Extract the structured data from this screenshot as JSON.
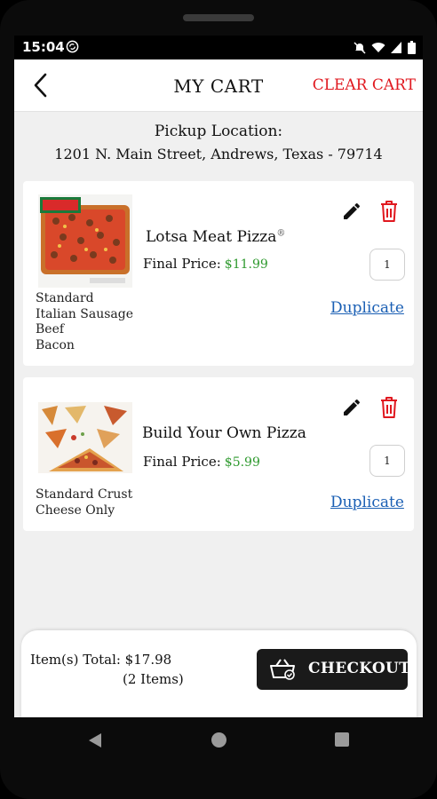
{
  "status_bar": {
    "time": "15:04"
  },
  "header": {
    "title": "MY CART",
    "clear_label": "CLEAR CART"
  },
  "pickup": {
    "label": "Pickup Location:",
    "address": "1201 N. Main Street, Andrews, Texas - 79714"
  },
  "cart": {
    "items": [
      {
        "name": "Lotsa Meat Pizza",
        "registered": "®",
        "final_price_label": "Final Price:",
        "price": "$11.99",
        "quantity": "1",
        "options": [
          "Standard",
          "Italian Sausage",
          "Beef",
          "Bacon"
        ],
        "duplicate_label": "Duplicate"
      },
      {
        "name": "Build Your Own Pizza",
        "final_price_label": "Final Price:",
        "price": "$5.99",
        "quantity": "1",
        "options": [
          "Standard Crust",
          "Cheese Only"
        ],
        "duplicate_label": "Duplicate"
      }
    ]
  },
  "footer": {
    "total_label": "Item(s) Total: $17.98",
    "items_count": "(2 Items)",
    "checkout_label": "CHECKOUT"
  },
  "colors": {
    "accent_red": "#e0181f",
    "price_green": "#2f9a2f",
    "link_blue": "#1a5fb4",
    "checkout_bg": "#1a1a1a"
  },
  "icons": [
    "back-arrow-icon",
    "edit-pencil-icon",
    "trash-icon",
    "basket-icon",
    "nav-back-icon",
    "nav-home-icon",
    "nav-recents-icon"
  ]
}
